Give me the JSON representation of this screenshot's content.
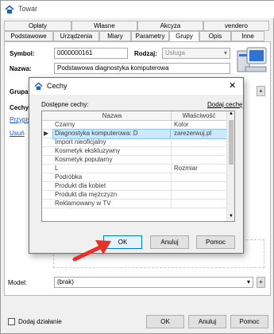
{
  "window": {
    "title": "Towar"
  },
  "tabs_row1": [
    "Opłaty",
    "Własne",
    "Akcyza",
    "vendero"
  ],
  "tabs_row2": [
    "Podstawowe",
    "Urządzenia",
    "Miary",
    "Parametry",
    "Grupy",
    "Opis",
    "Inne"
  ],
  "active_tab": "Grupy",
  "form": {
    "symbol_label": "Symbol:",
    "symbol_value": "0000000161",
    "rodzaj_label": "Rodzaj:",
    "rodzaj_value": "Usługa",
    "nazwa_label": "Nazwa:",
    "nazwa_value": "Podstawowa diagnostyka komputerowa",
    "grupa_label": "Grupa:",
    "cechy_label": "Cechy to",
    "przypisz_link": "Przypis",
    "usun_link": "Usuń",
    "model_label": "Model:",
    "model_value": "(brak)",
    "add_symbol": "+",
    "dodaj_dzialanie": "Dodaj działanie"
  },
  "bottom_buttons": {
    "ok": "OK",
    "anuluj": "Anuluj",
    "pomoc": "Pomoc"
  },
  "dialog": {
    "title": "Cechy",
    "close": "✕",
    "available_label": "Dostępne cechy:",
    "add_link": "Dodaj cechę",
    "columns": [
      "Nazwa",
      "Właściwość"
    ],
    "rows": [
      {
        "name": "Czarny",
        "prop": "Kolor"
      },
      {
        "name": "Diagnostyka komputerowa: D",
        "prop": "zarezerwuj.pl",
        "selected": true
      },
      {
        "name": "Import nieoficjalny",
        "prop": ""
      },
      {
        "name": "Kosmetyk ekskluzywny",
        "prop": ""
      },
      {
        "name": "Kosmetyk popularny",
        "prop": ""
      },
      {
        "name": "L",
        "prop": "Rozmiar"
      },
      {
        "name": "Podróbka",
        "prop": ""
      },
      {
        "name": "Produkt dla kobiet",
        "prop": ""
      },
      {
        "name": "Produkt dla mężczyzn",
        "prop": ""
      },
      {
        "name": "Reklamowany w TV",
        "prop": ""
      }
    ],
    "ok": "OK",
    "anuluj": "Anuluj",
    "pomoc": "Pomoc"
  },
  "colors": {
    "selection": "#cce8ff",
    "arrow": "#e8302a",
    "default_button_border": "#0078d7"
  }
}
